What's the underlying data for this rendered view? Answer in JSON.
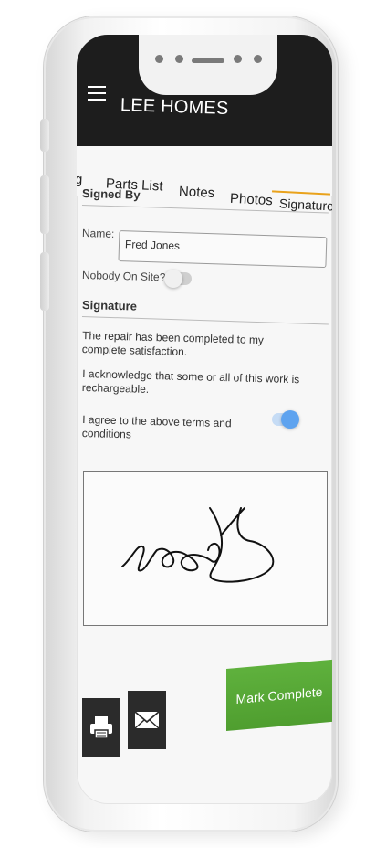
{
  "app": {
    "title": "LEE HOMES"
  },
  "tabs": [
    "Log",
    "Parts List",
    "Notes",
    "Photos",
    "Signature"
  ],
  "tabs_visible": {
    "log": "g",
    "parts": "Parts List",
    "notes": "Notes",
    "photos": "Photos",
    "signature": "Signature"
  },
  "active_tab": "Signature",
  "signed_by": {
    "section_title": "Signed By",
    "name_label": "Name:",
    "name_value": "Fred Jones",
    "nobody_label": "Nobody On Site?:",
    "nobody_on_site": false
  },
  "signature": {
    "section_title": "Signature",
    "statement1": "The repair has been completed to my complete satisfaction.",
    "statement2": "I acknowledge that some or all of this work is rechargeable.",
    "agree_label": "I agree to the above terms and conditions",
    "agreed": true
  },
  "actions": {
    "mark_complete": "Mark Complete"
  },
  "icons": {
    "menu": "hamburger-icon",
    "print": "printer-icon",
    "email": "envelope-icon"
  },
  "colors": {
    "topbar": "#1d1d1d",
    "tab_accent": "#e9a21b",
    "complete_button": "#56a835",
    "toggle_on": "#5ea3ef"
  }
}
